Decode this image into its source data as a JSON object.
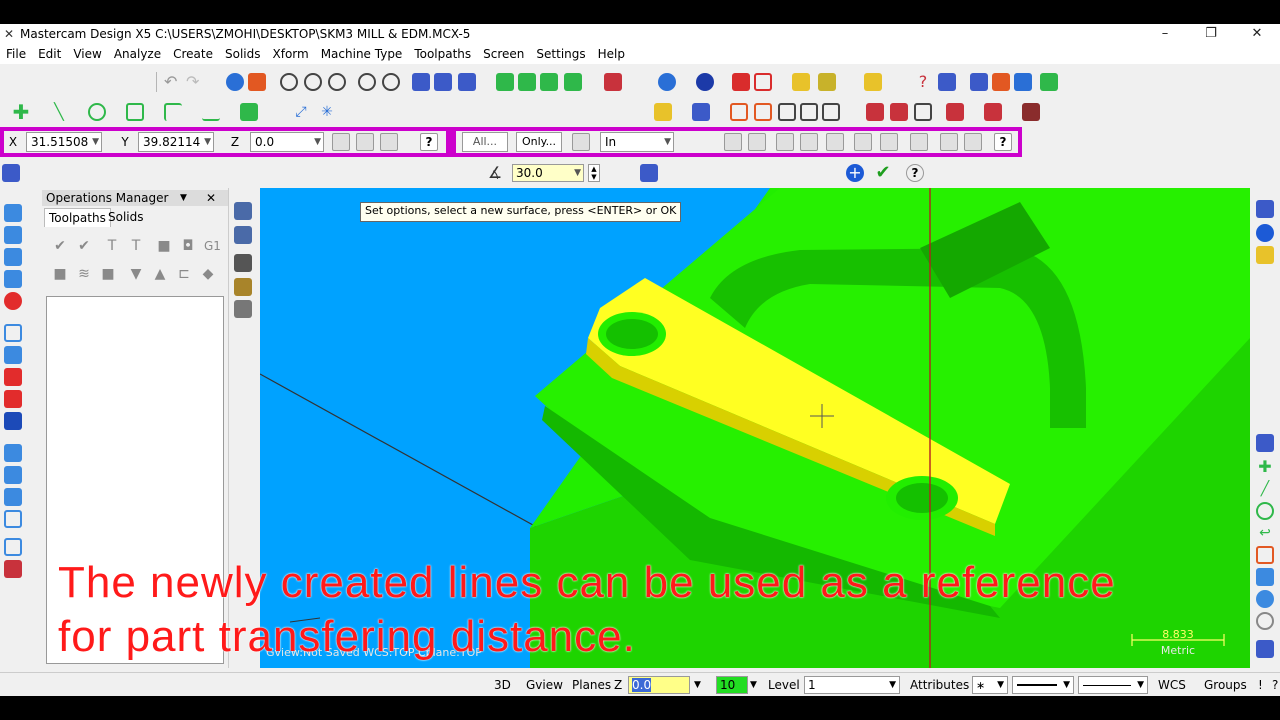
{
  "window": {
    "title": "Mastercam Design X5  C:\\USERS\\ZMOHI\\DESKTOP\\SKM3 MILL & EDM.MCX-5",
    "minimize_glyph": "–",
    "restore_glyph": "❐",
    "close_glyph": "✕"
  },
  "menu": [
    "File",
    "Edit",
    "View",
    "Analyze",
    "Create",
    "Solids",
    "Xform",
    "Machine Type",
    "Toolpaths",
    "Screen",
    "Settings",
    "Help"
  ],
  "autocursor": {
    "x_label": "X",
    "x_value": "31.51508",
    "y_label": "Y",
    "y_value": "39.82114",
    "z_label": "Z",
    "z_value": "0.0",
    "all_label": "All...",
    "only_label": "Only...",
    "units_value": "In"
  },
  "ribbon": {
    "angle_value": "30.0"
  },
  "ops_manager": {
    "title": "Operations Manager",
    "tabs": [
      "Toolpaths",
      "Solids"
    ],
    "g1_label": "G1"
  },
  "viewport": {
    "prompt": "Set options, select a new surface, press <ENTER> or OK",
    "gview_status": "Gview:Not Saved   WCS:TOP   Cplane:TOP",
    "scale_value": "8.833",
    "scale_unit": "Metric",
    "colors": {
      "background": "#00a2ff",
      "part": "#22ee00",
      "selected_face": "#ffff22"
    }
  },
  "status": {
    "mode_3d": "3D",
    "gview": "Gview",
    "planes": "Planes",
    "z_label": "Z",
    "z_value": "0.0",
    "color_value": "10",
    "level_label": "Level",
    "level_value": "1",
    "attributes": "Attributes",
    "wcs": "WCS",
    "groups": "Groups"
  },
  "caption": {
    "line1": "The newly created lines can be used as a reference",
    "line2": "for part transfering distance."
  }
}
